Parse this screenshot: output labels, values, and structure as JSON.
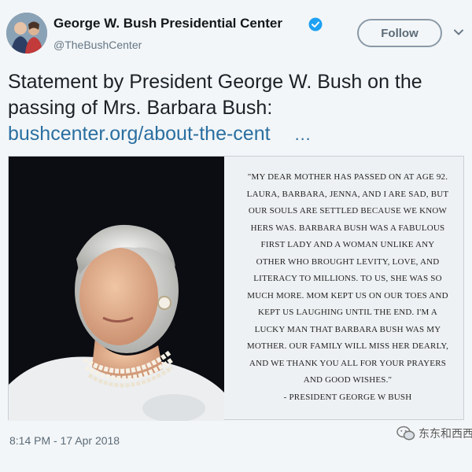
{
  "account": {
    "display_name": "George W. Bush Presidential Center",
    "handle": "@TheBushCenter",
    "verified": true
  },
  "follow_label": "Follow",
  "tweet": {
    "text": "Statement by President George W. Bush on the passing of Mrs. Barbara Bush:",
    "link": "bushcenter.org/about-the-cent",
    "ellipsis": "…",
    "timestamp": "8:14 PM - 17 Apr 2018"
  },
  "quote": {
    "lines": [
      "\"My dear mother has passed on at age 92.",
      "Laura, Barbara, Jenna, and I are sad, but",
      "our souls are settled because we know",
      "hers was. Barbara Bush was a fabulous",
      "First Lady and a woman unlike any",
      "other who brought levity, love, and",
      "literacy to millions. To us, she was so",
      "much more. Mom kept us on our toes and",
      "kept us laughing until the end. I'm a",
      "lucky man that Barbara Bush was my",
      "mother. Our family will miss her dearly,",
      "and we thank you all for your prayers",
      "and good wishes.\""
    ],
    "attribution": "- President George W Bush"
  },
  "watermark": "东东和西西",
  "icons": {
    "verified": "verified-badge-icon",
    "caret": "chevron-down-icon",
    "watermark": "wechat-icon"
  },
  "colors": {
    "link": "#2a6fa0",
    "verified": "#1da1f2"
  }
}
